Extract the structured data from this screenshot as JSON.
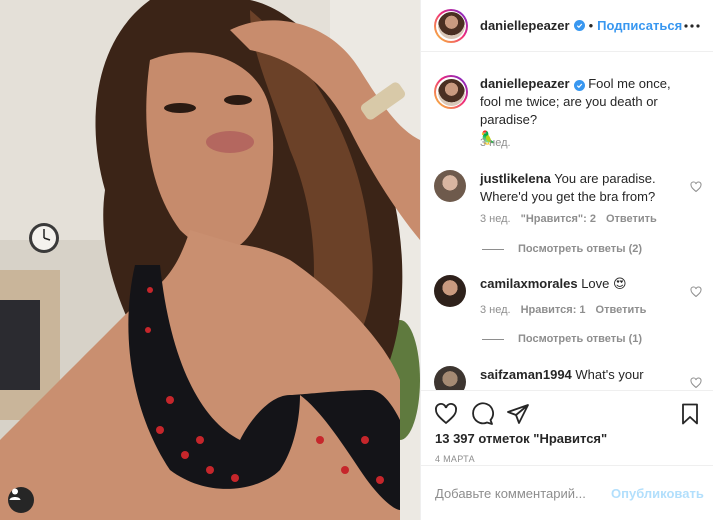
{
  "post": {
    "author": {
      "username": "daniellepeazer",
      "verified": true
    },
    "header": {
      "separator": "•",
      "follow_label": "Подписаться",
      "more_icon": "more-horizontal-icon"
    },
    "caption": {
      "username": "daniellepeazer",
      "text": "Fool me once, fool me twice; are you death or paradise?",
      "emoji": "🦜",
      "time": "3 нед."
    },
    "comments": [
      {
        "username": "justlikelena",
        "text": "You are paradise. Where'd you get the bra from?",
        "time": "3 нед.",
        "likes_label": "\"Нравится\": 2",
        "reply_label": "Ответить",
        "view_replies": "Посмотреть ответы (2)"
      },
      {
        "username": "camilaxmorales",
        "text": "Love 😍",
        "time": "3 нед.",
        "likes_label": "Нравится: 1",
        "reply_label": "Ответить",
        "view_replies": "Посмотреть ответы (1)"
      },
      {
        "username": "saifzaman1994",
        "text": "What's your"
      }
    ],
    "likes_text": "13 397 отметок \"Нравится\"",
    "date": "4 МАРТА",
    "add_comment_placeholder": "Добавьте комментарий...",
    "publish_label": "Опубликовать",
    "colors": {
      "accent": "#3897f0",
      "publish_disabled": "#b2dffc",
      "muted": "#8e8e8e",
      "text": "#262626",
      "divider": "#efefef"
    }
  }
}
